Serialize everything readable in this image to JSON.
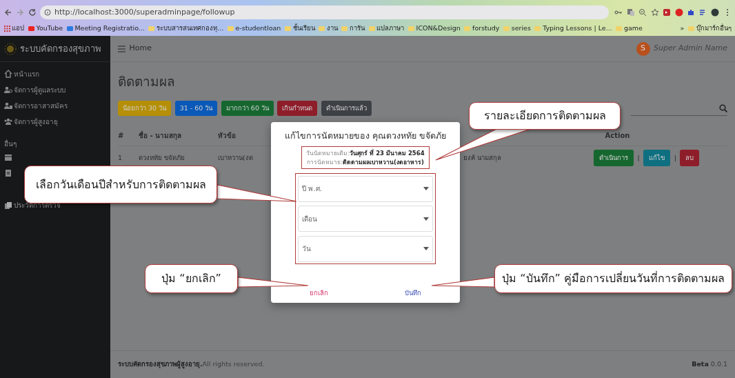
{
  "browser": {
    "url": "http://localhost:3000/superadminpage/followup",
    "bookmarks": [
      "แอป",
      "YouTube",
      "Meeting Registratio...",
      "ระบบสารสนเทศกองทุ...",
      "e-studentloan",
      "ชั้นเรียน",
      "งาน",
      "การัน",
      "แปลภาษา",
      "ICON&Design",
      "forstudy",
      "series",
      "Typing Lessons | Le...",
      "game",
      "»",
      "บุ๊กมาร์กอื่นๆ"
    ]
  },
  "sidebar": {
    "brand": "ระบบคัดกรองสุขภาพ",
    "items": [
      {
        "label": "หน้าแรก"
      },
      {
        "label": "จัดการผู้ดูแลระบบ"
      },
      {
        "label": "จัดการอาสาสมัคร"
      },
      {
        "label": "จัดการผู้สูงอายุ"
      }
    ],
    "section": "อื่นๆ",
    "more_items": [
      {
        "kind": "calendar"
      },
      {
        "kind": "document"
      },
      {
        "kind": "history",
        "label": "ประวัติการตรวจ"
      }
    ]
  },
  "topbar": {
    "title": "Home",
    "avatar": "S",
    "user": "Super Admin Name"
  },
  "page": {
    "title": "ติดตามผล",
    "filters": [
      {
        "label": "น้อยกว่า 30 วัน",
        "color": "#b58f07"
      },
      {
        "label": "31 - 60 วัน",
        "color": "#0a58b8"
      },
      {
        "label": "มากกว่า 60 วัน",
        "color": "#15672f"
      },
      {
        "label": "เกินกำหนด",
        "color": "#8e1d2a"
      },
      {
        "label": "ดำเนินการแล้ว",
        "color": "#3d4146"
      }
    ],
    "table": {
      "columns": [
        "#",
        "ชื่อ - นามสกุล",
        "หัวข้อ",
        "Action"
      ],
      "rows": [
        {
          "number": "1",
          "name": "ดวงหทัย ขจัดภัย",
          "topic": "เบาหวาน(งด",
          "column_4": "ยงค์ นามสกุล",
          "separators": [
            "|",
            "|"
          ],
          "actions": [
            {
              "label": "ดำเนินการ",
              "kind": "process"
            },
            {
              "label": "แก้ไข",
              "kind": "edit"
            },
            {
              "label": "ลบ",
              "kind": "delete"
            }
          ]
        }
      ]
    }
  },
  "modal": {
    "title": "แก้ไขการนัดหมายของ คุณดวงหทัย ขจัดภัย",
    "info": [
      "วันนัดหมายเดิม:**วันศุกร์ ที่ 23 มีนาคม 2564**",
      "การนัดหมาย:**ติดตามผลเบาหวาน(งดอาหาร)**"
    ],
    "selects": [
      {
        "placeholder": "ปี พ.ศ."
      },
      {
        "placeholder": "เดือน"
      },
      {
        "placeholder": "วัน"
      }
    ],
    "buttons": [
      {
        "label": "ยกเลิก",
        "kind": "cancel"
      },
      {
        "label": "บันทึก",
        "kind": "save"
      }
    ]
  },
  "callouts": [
    "รายละเอียดการติดตามผล",
    "เลือกวันเดือนปีสำหรับการติดตามผล",
    "ปุ่ม “ยกเลิก”",
    "ปุ่ม “บันทึก” คู่มือการเปลี่ยนวันที่การติดตามผล"
  ],
  "footer": {
    "left": "**ระบบคัดกรองสุขภาพผู้สูงอายุ.**All rights reserved.",
    "right": "**Beta** 0.0.1"
  }
}
